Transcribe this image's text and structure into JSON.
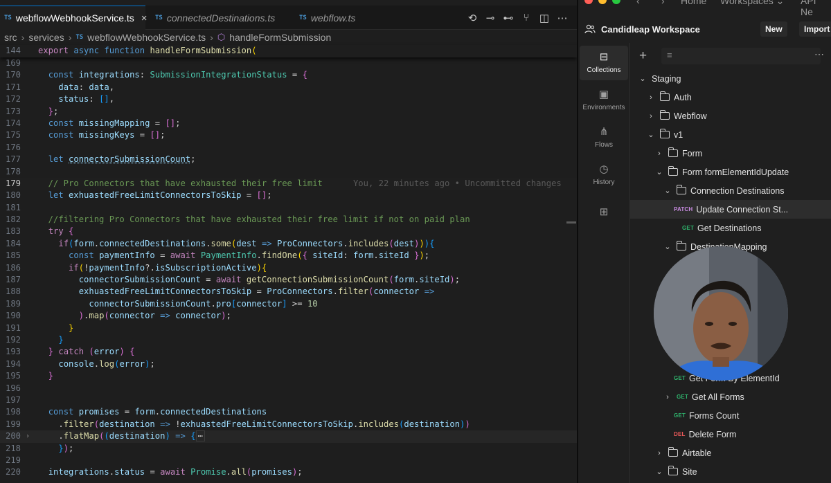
{
  "editor": {
    "tabs": [
      {
        "label": "webflowWebhookService.ts",
        "icon": "TS",
        "close": "×"
      },
      {
        "label": "connectedDestinations.ts",
        "icon": "TS"
      },
      {
        "label": "webflow.ts",
        "icon": "TS"
      }
    ],
    "breadcrumb": [
      "src",
      "services",
      "webflowWebhookService.ts",
      "handleFormSubmission"
    ],
    "breadcrumb_ts": "TS",
    "blame": "You, 22 minutes ago • Uncommitted changes",
    "current_line": "179"
  },
  "client": {
    "titlebar": {
      "home": "Home",
      "workspaces": "Workspaces ⌄",
      "api": "API Ne"
    },
    "workspace_title": "Candidleap Workspace",
    "new_label": "New",
    "import_label": "Import",
    "sidebar": [
      {
        "label": "Collections",
        "icon": "collections-icon"
      },
      {
        "label": "Environments",
        "icon": "environments-icon"
      },
      {
        "label": "Flows",
        "icon": "flows-icon"
      },
      {
        "label": "History",
        "icon": "history-icon"
      }
    ],
    "tree": [
      {
        "label": "Staging",
        "chev": "⌄",
        "folder": false,
        "method": ""
      },
      {
        "label": "Auth",
        "chev": "›",
        "folder": true,
        "method": ""
      },
      {
        "label": "Webflow",
        "chev": "›",
        "folder": true,
        "method": ""
      },
      {
        "label": "v1",
        "chev": "⌄",
        "folder": true,
        "method": ""
      },
      {
        "label": "Form",
        "chev": "›",
        "folder": true,
        "method": ""
      },
      {
        "label": "Form formElementIdUpdate",
        "chev": "⌄",
        "folder": true,
        "method": ""
      },
      {
        "label": "Connection Destinations",
        "chev": "⌄",
        "folder": true,
        "method": ""
      },
      {
        "label": "Update Connection St...",
        "chev": "",
        "folder": false,
        "method": "PATCH"
      },
      {
        "label": "Get Destinations",
        "chev": "",
        "folder": false,
        "method": "GET"
      },
      {
        "label": "DestinationMapping",
        "chev": "⌄",
        "folder": true,
        "method": ""
      },
      {
        "label": "Get Form By ElementId",
        "chev": "",
        "folder": false,
        "method": "GET"
      },
      {
        "label": "Get All Forms",
        "chev": "›",
        "folder": false,
        "method": "GET"
      },
      {
        "label": "Forms Count",
        "chev": "",
        "folder": false,
        "method": "GET"
      },
      {
        "label": "Delete Form",
        "chev": "",
        "folder": false,
        "method": "DEL"
      },
      {
        "label": "Airtable",
        "chev": "›",
        "folder": true,
        "method": ""
      },
      {
        "label": "Site",
        "chev": "⌄",
        "folder": true,
        "method": ""
      }
    ]
  }
}
